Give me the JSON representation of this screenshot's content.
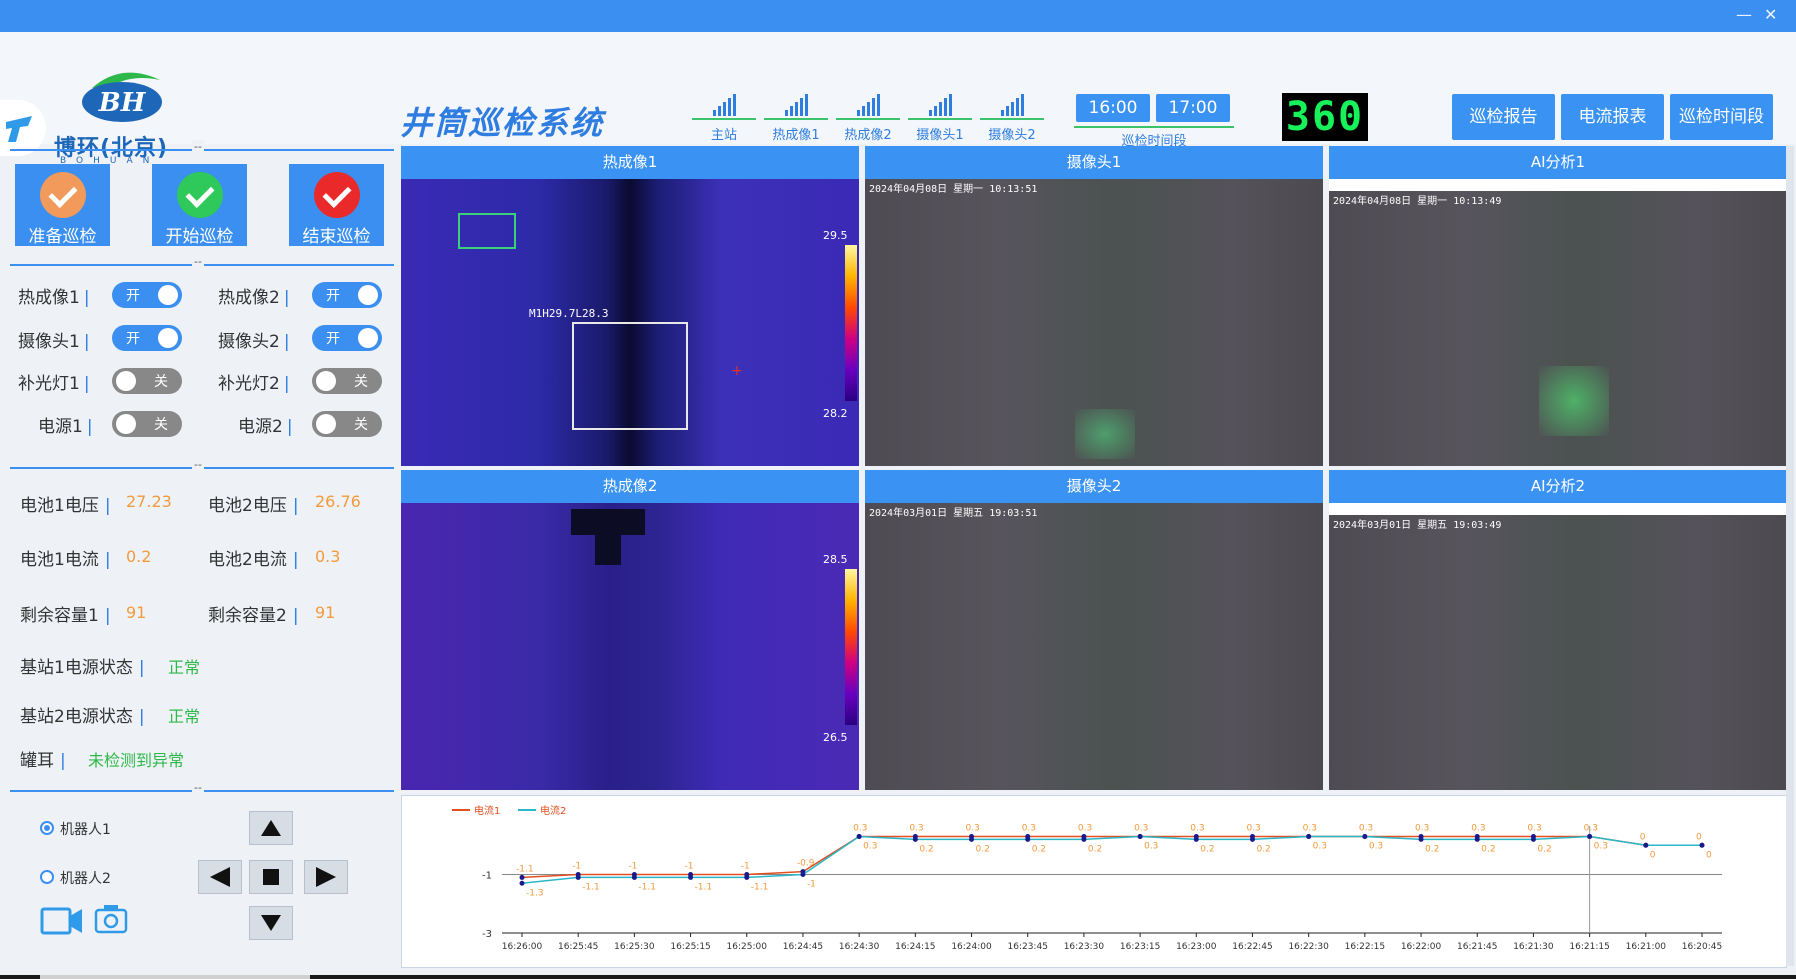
{
  "window": {
    "minimize": "—",
    "close": "✕"
  },
  "logo": {
    "monogram": "BH",
    "name": "博环(北京)",
    "sub": "BOHUAN"
  },
  "app_title": "井筒巡检系统",
  "signals": [
    {
      "label": "主站"
    },
    {
      "label": "热成像1"
    },
    {
      "label": "热成像2"
    },
    {
      "label": "摄像头1"
    },
    {
      "label": "摄像头2"
    }
  ],
  "time": {
    "start": "16:00",
    "end": "17:00",
    "label": "巡检时间段"
  },
  "counter": "360",
  "header_buttons": {
    "report": "巡检报告",
    "current_report": "电流报表",
    "time_period": "巡检时间段"
  },
  "action_buttons": {
    "prepare": "准备巡检",
    "start": "开始巡检",
    "end": "结束巡检"
  },
  "toggles": [
    {
      "label": "热成像1",
      "state": "开",
      "on": true
    },
    {
      "label": "热成像2",
      "state": "开",
      "on": true
    },
    {
      "label": "摄像头1",
      "state": "开",
      "on": true
    },
    {
      "label": "摄像头2",
      "state": "开",
      "on": true
    },
    {
      "label": "补光灯1",
      "state": "关",
      "on": false
    },
    {
      "label": "补光灯2",
      "state": "关",
      "on": false
    },
    {
      "label": "电源1",
      "state": "关",
      "on": false
    },
    {
      "label": "电源2",
      "state": "关",
      "on": false
    }
  ],
  "status": {
    "battery1_voltage": {
      "label": "电池1电压",
      "value": "27.23"
    },
    "battery2_voltage": {
      "label": "电池2电压",
      "value": "26.76"
    },
    "battery1_current": {
      "label": "电池1电流",
      "value": "0.2"
    },
    "battery2_current": {
      "label": "电池2电流",
      "value": "0.3"
    },
    "capacity1": {
      "label": "剩余容量1",
      "value": "91"
    },
    "capacity2": {
      "label": "剩余容量2",
      "value": "91"
    },
    "station1_power": {
      "label": "基站1电源状态",
      "value": "正常"
    },
    "station2_power": {
      "label": "基站2电源状态",
      "value": "正常"
    },
    "ear": {
      "label": "罐耳",
      "value": "未检测到异常"
    }
  },
  "robots": [
    {
      "label": "机器人1",
      "selected": true
    },
    {
      "label": "机器人2",
      "selected": false
    }
  ],
  "separator": "--",
  "videos": {
    "thermal1": {
      "title": "热成像1",
      "overlay": "M1H29.7L28.3",
      "scale_max": "29.5",
      "scale_min": "28.2"
    },
    "camera1": {
      "title": "摄像头1",
      "timestamp": "2024年04月08日 星期一 10:13:51"
    },
    "ai1": {
      "title": "AI分析1",
      "timestamp": "2024年04月08日 星期一 10:13:49"
    },
    "thermal2": {
      "title": "热成像2",
      "scale_max": "28.5",
      "scale_min": "26.5"
    },
    "camera2": {
      "title": "摄像头2",
      "timestamp": "2024年03月01日 星期五 19:03:51"
    },
    "ai2": {
      "title": "AI分析2",
      "timestamp": "2024年03月01日 星期五 19:03:49"
    }
  },
  "colors": {
    "accent": "#3a8ff0",
    "series1": "#e05020",
    "series2": "#2ab8c8",
    "value_orange": "#f29a3c",
    "ok_green": "#2fb84a"
  },
  "chart_data": {
    "type": "line",
    "x": [
      "16:26:00",
      "16:25:45",
      "16:25:30",
      "16:25:15",
      "16:25:00",
      "16:24:45",
      "16:24:30",
      "16:24:15",
      "16:24:00",
      "16:23:45",
      "16:23:30",
      "16:23:15",
      "16:23:00",
      "16:22:45",
      "16:22:30",
      "16:22:15",
      "16:22:00",
      "16:21:45",
      "16:21:30",
      "16:21:15",
      "16:21:00",
      "16:20:45"
    ],
    "series": [
      {
        "name": "电流1",
        "values": [
          -1.1,
          -1,
          -1,
          -1,
          -1,
          -0.9,
          0.3,
          0.3,
          0.3,
          0.3,
          0.3,
          0.3,
          0.3,
          0.3,
          0.3,
          0.3,
          0.3,
          0.3,
          0.3,
          0.3,
          0,
          0
        ]
      },
      {
        "name": "电流2",
        "values": [
          -1.3,
          -1.1,
          -1.1,
          -1.1,
          -1.1,
          -1,
          0.3,
          0.2,
          0.2,
          0.2,
          0.2,
          0.3,
          0.2,
          0.2,
          0.3,
          0.3,
          0.2,
          0.2,
          0.2,
          0.3,
          0,
          0
        ]
      }
    ],
    "yticks": [
      -1,
      -3
    ],
    "ylim": [
      -3,
      1
    ],
    "legend": "top-left",
    "grid": false
  }
}
